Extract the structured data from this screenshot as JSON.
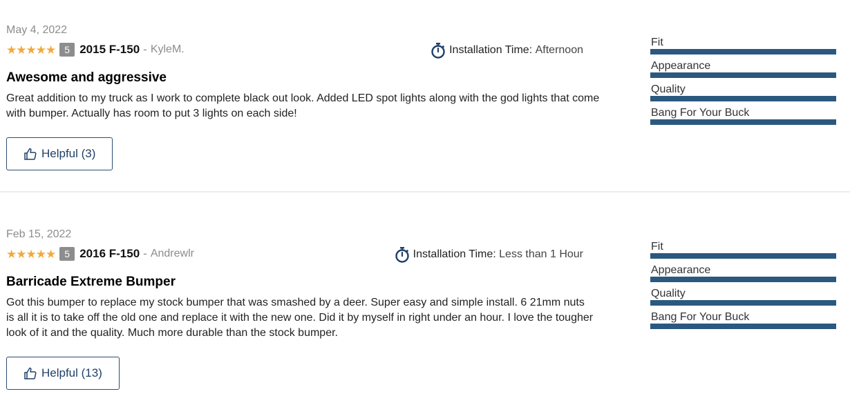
{
  "reviews": [
    {
      "date": "May 4, 2022",
      "stars": "★★★★★",
      "score": "5",
      "vehicle": "2015 F-150",
      "separator": "-",
      "author": "KyleM.",
      "install_label": "Installation Time:",
      "install_value": "Afternoon",
      "title": "Awesome and aggressive",
      "body": "Great addition to my truck as I work to complete black out look. Added LED spot lights along with the god lights that come with bumper. Actually has room to put 3 lights on each side!",
      "helpful_label": "Helpful (3)",
      "ratings": [
        {
          "label": "Fit",
          "value": 1.0
        },
        {
          "label": "Appearance",
          "value": 1.0
        },
        {
          "label": "Quality",
          "value": 1.0
        },
        {
          "label": "Bang For Your Buck",
          "value": 1.0
        }
      ]
    },
    {
      "date": "Feb 15, 2022",
      "stars": "★★★★★",
      "score": "5",
      "vehicle": "2016 F-150",
      "separator": "-",
      "author": "Andrewlr",
      "install_label": "Installation Time:",
      "install_value": "Less than 1 Hour",
      "title": "Barricade Extreme Bumper",
      "body": "Got this bumper to replace my stock bumper that was smashed by a deer. Super easy and simple install. 6 21mm nuts is all it is to take off the old one and replace it with the new one. Did it by myself in right under an hour. I love the tougher look of it and the quality. Much more durable than the stock bumper.",
      "helpful_label": "Helpful (13)",
      "ratings": [
        {
          "label": "Fit",
          "value": 1.0
        },
        {
          "label": "Appearance",
          "value": 1.0
        },
        {
          "label": "Quality",
          "value": 1.0
        },
        {
          "label": "Bang For Your Buck",
          "value": 1.0
        }
      ]
    }
  ],
  "colors": {
    "star": "#f2a93b",
    "rating_fill": "#2b587f",
    "button_border": "#2b4b74"
  }
}
